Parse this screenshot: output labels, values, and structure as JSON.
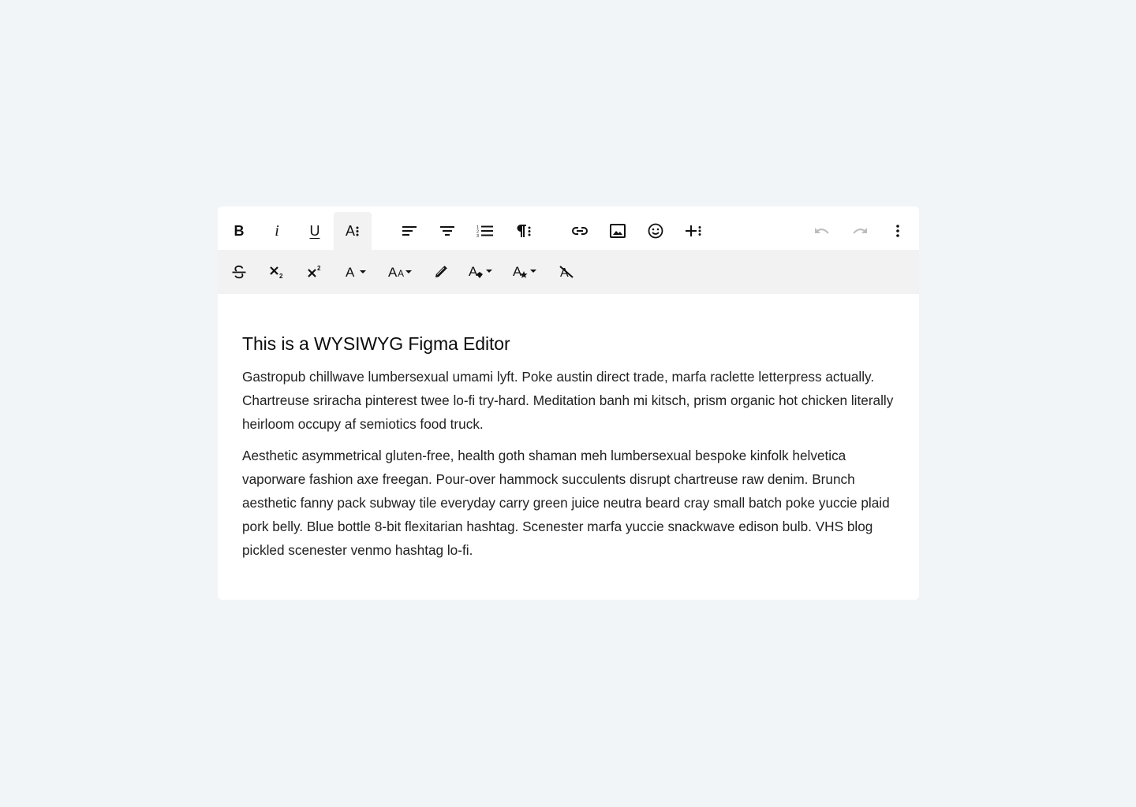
{
  "editor": {
    "heading": "This is a WYSIWYG Figma Editor",
    "paragraphs": [
      "Gastropub chillwave lumbersexual umami lyft. Poke austin direct trade, marfa raclette letterpress actually. Chartreuse sriracha pinterest twee lo-fi try-hard. Meditation banh mi kitsch, prism organic hot chicken literally heirloom occupy af semiotics food truck.",
      "Aesthetic asymmetrical gluten-free, health goth shaman meh lumbersexual bespoke kinfolk helvetica vaporware fashion axe freegan. Pour-over hammock succulents disrupt chartreuse raw denim. Brunch aesthetic fanny pack subway tile everyday carry green juice neutra beard cray small batch poke yuccie plaid pork belly. Blue bottle 8-bit flexitarian hashtag. Scenester marfa yuccie snackwave edison bulb. VHS blog pickled scenester venmo hashtag lo-fi."
    ]
  },
  "toolbar": {
    "bold_glyph": "B",
    "italic_glyph": "i",
    "underline_glyph": "U",
    "text_options_glyph": "A",
    "primary_icons": [
      "bold-icon",
      "italic-icon",
      "underline-icon",
      "more-text-icon",
      "align-left-icon",
      "align-center-icon",
      "ordered-list-icon",
      "paragraph-format-icon",
      "link-icon",
      "image-icon",
      "emoji-icon",
      "insert-more-icon",
      "undo-icon",
      "redo-icon",
      "more-vertical-icon"
    ],
    "secondary_icons": [
      "strikethrough-icon",
      "subscript-icon",
      "superscript-icon",
      "font-family-icon",
      "font-size-icon",
      "highlight-pen-icon",
      "text-color-icon",
      "inline-style-icon",
      "clear-format-icon"
    ]
  },
  "colors": {
    "page_background": "#f2f5f8",
    "editor_background": "#ffffff",
    "secondary_toolbar": "#f2f2f2",
    "icon": "#111111",
    "disabled_icon": "#bdbdbd"
  }
}
